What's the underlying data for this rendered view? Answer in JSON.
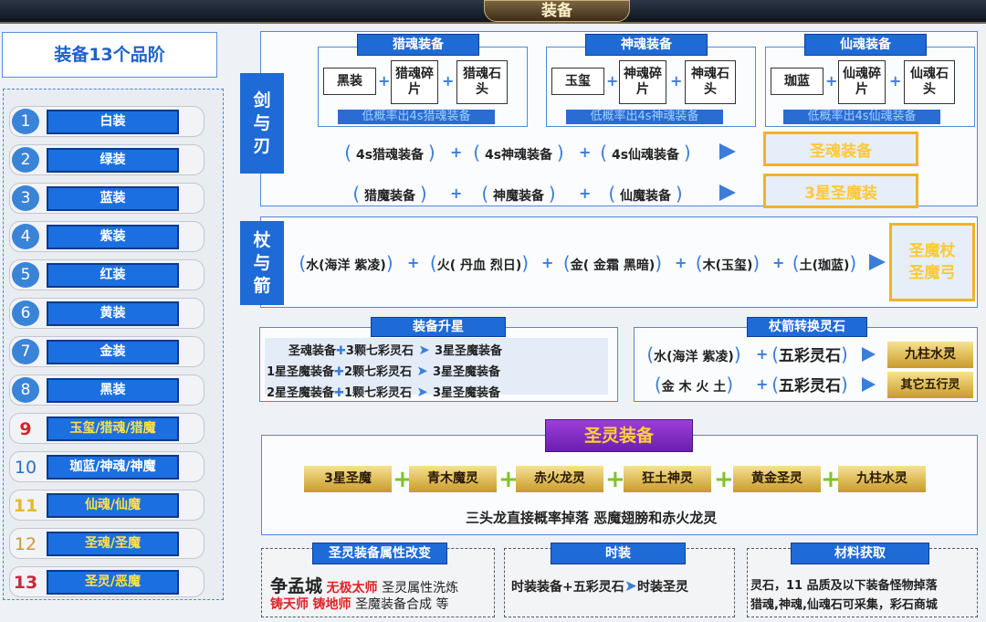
{
  "window": {
    "title": "装备"
  },
  "grades": {
    "title": "装备13个品阶",
    "items": [
      {
        "num": "1",
        "label": "白装"
      },
      {
        "num": "2",
        "label": "绿装"
      },
      {
        "num": "3",
        "label": "蓝装"
      },
      {
        "num": "4",
        "label": "紫装"
      },
      {
        "num": "5",
        "label": "红装"
      },
      {
        "num": "6",
        "label": "黄装"
      },
      {
        "num": "7",
        "label": "金装"
      },
      {
        "num": "8",
        "label": "黑装"
      },
      {
        "num": "9",
        "label": "玉玺/猎魂/猎魔"
      },
      {
        "num": "10",
        "label": "珈蓝/神魂/神魔"
      },
      {
        "num": "11",
        "label": "仙魂/仙魔"
      },
      {
        "num": "12",
        "label": "圣魂/圣魔"
      },
      {
        "num": "13",
        "label": "圣灵/恶魔"
      }
    ]
  },
  "sword": {
    "label": [
      "剑",
      "与",
      "刃"
    ],
    "groups": [
      {
        "title": "猎魂装备",
        "base": "黑装",
        "piece": "猎魂碎片",
        "stone": "猎魂石头",
        "note": "低概率出4s猎魂装备"
      },
      {
        "title": "神魂装备",
        "base": "玉玺",
        "piece": "神魂碎片",
        "stone": "神魂石头",
        "note": "低概率出4s神魂装备"
      },
      {
        "title": "仙魂装备",
        "base": "珈蓝",
        "piece": "仙魂碎片",
        "stone": "仙魂石头",
        "note": "低概率出4s仙魂装备"
      }
    ],
    "row1": [
      "4s猎魂装备",
      "4s神魂装备",
      "4s仙魂装备"
    ],
    "row1_result": "圣魂装备",
    "row2": [
      "猎魔装备",
      "神魔装备",
      "仙魔装备"
    ],
    "row2_result": "3星圣魔装"
  },
  "staff": {
    "label": [
      "杖",
      "与",
      "箭"
    ],
    "chips": [
      "水(海洋 紫凌)",
      "火( 丹血 烈日)",
      "金( 金霜 黑暗)",
      "木(玉玺)",
      "土(珈蓝)"
    ],
    "result": [
      "圣魔杖",
      "圣魔弓"
    ]
  },
  "upgrade": {
    "title": "装备升星",
    "rows": [
      {
        "a": "圣魂装备",
        "b": "3颗七彩灵石",
        "c": "3星圣魔装备"
      },
      {
        "a": "1星圣魔装备",
        "b": "2颗七彩灵石",
        "c": "3星圣魔装备"
      },
      {
        "a": "2星圣魔装备",
        "b": "1颗七彩灵石",
        "c": "3星圣魔装备"
      }
    ]
  },
  "convert": {
    "title": "杖箭转换灵石",
    "rows": [
      {
        "a": "水(海洋 紫凌)",
        "b": "五彩灵石",
        "c": "九柱水灵"
      },
      {
        "a": "金 木 火 土",
        "b": "五彩灵石",
        "c": "其它五行灵"
      }
    ]
  },
  "holy": {
    "title": "圣灵装备",
    "chain": [
      "3星圣魔",
      "青木魔灵",
      "赤火龙灵",
      "狂土神灵",
      "黄金圣灵",
      "九柱水灵"
    ],
    "note": "三头龙直接概率掉落  恶魔翅膀和赤火龙灵"
  },
  "attr": {
    "title": "圣灵装备属性改变",
    "city": "争孟城",
    "npc1": "无极太师",
    "text1": "圣灵属性洗炼",
    "npc2": "铸天师",
    "npc3": "铸地师",
    "text2": "圣魔装备合成 等"
  },
  "fashion": {
    "title": "时装",
    "a": "时装装备+五彩灵石",
    "b": "时装圣灵"
  },
  "material": {
    "title": "材料获取",
    "line1": "灵石，11 品质及以下装备怪物掉落",
    "line2": "猎魂,神魂,仙魂石可采集，彩石商城"
  },
  "colors": {
    "accent": "#1e6ad6",
    "gold": "#f0b328",
    "purple": "#7b2bc4"
  }
}
